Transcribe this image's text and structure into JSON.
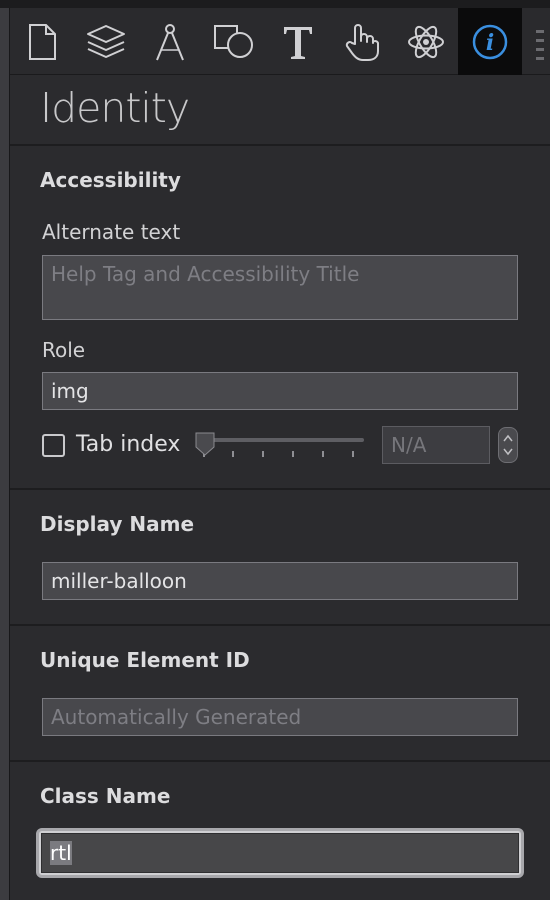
{
  "toolbar": {
    "icons": [
      "document-icon",
      "layers-icon",
      "compass-icon",
      "shapes-icon",
      "text-tool-icon",
      "hand-pointer-icon",
      "atom-icon",
      "info-icon"
    ],
    "active": "info-icon",
    "accent_color": "#3a8fe0"
  },
  "identity": {
    "title": "Identity"
  },
  "accessibility": {
    "heading": "Accessibility",
    "alt_text_label": "Alternate text",
    "alt_text_placeholder": "Help Tag and Accessibility Title",
    "role_label": "Role",
    "role_value": "img",
    "tab_index_label": "Tab index",
    "tab_index_value": "N/A",
    "tab_index_checked": false
  },
  "display_name": {
    "heading": "Display Name",
    "value": "miller-balloon"
  },
  "unique_id": {
    "heading": "Unique Element ID",
    "placeholder": "Automatically Generated"
  },
  "class_name": {
    "heading": "Class Name",
    "value": "rtl"
  }
}
